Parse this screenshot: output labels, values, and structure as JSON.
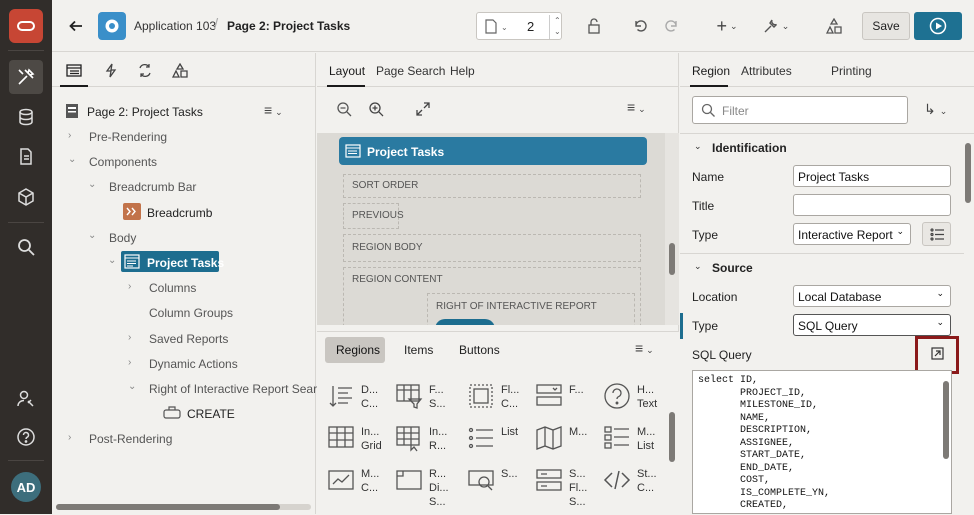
{
  "app": {
    "name": "Application 103",
    "page_title": "Page 2: Project Tasks",
    "page_number": "2"
  },
  "toolbar": {
    "save_label": "Save"
  },
  "user": {
    "initials": "AD"
  },
  "tree": {
    "header": "Page 2: Project Tasks",
    "items": [
      "Pre-Rendering",
      "Components",
      "Breadcrumb Bar",
      "Breadcrumb",
      "Body",
      "Project Tasks",
      "Columns",
      "Column Groups",
      "Saved Reports",
      "Dynamic Actions",
      "Right of Interactive Report Search",
      "CREATE",
      "Post-Rendering"
    ]
  },
  "layout": {
    "tabs": [
      "Layout",
      "Page Search",
      "Help"
    ],
    "region_title": "Project Tasks",
    "slots": [
      "SORT ORDER",
      "PREVIOUS",
      "REGION BODY",
      "REGION CONTENT",
      "RIGHT OF INTERACTIVE REPORT SEARCH BAR"
    ],
    "gallery_tabs": [
      "Regions",
      "Items",
      "Buttons"
    ],
    "gallery_items": [
      "D...\nC...",
      "F...\nS...",
      "Fl...\nC...",
      "F...",
      "H...\nText",
      "In...\nGrid",
      "In...\nR...",
      "List",
      "M...",
      "M...\nList",
      "M...\nC...",
      "R...\nDi...\nS...",
      "S...",
      "S...\nFl...\nS...",
      "St...\nC..."
    ]
  },
  "props": {
    "tabs": [
      "Region",
      "Attributes",
      "Printing"
    ],
    "filter_placeholder": "Filter",
    "identification": {
      "title": "Identification",
      "name_label": "Name",
      "name_value": "Project Tasks",
      "title_label": "Title",
      "title_value": "",
      "type_label": "Type",
      "type_value": "Interactive Report"
    },
    "source": {
      "title": "Source",
      "location_label": "Location",
      "location_value": "Local Database",
      "type_label": "Type",
      "type_value": "SQL Query",
      "sql_label": "SQL Query",
      "sql": "select ID,\n       PROJECT_ID,\n       MILESTONE_ID,\n       NAME,\n       DESCRIPTION,\n       ASSIGNEE,\n       START_DATE,\n       END_DATE,\n       COST,\n       IS_COMPLETE_YN,\n       CREATED,"
    }
  }
}
